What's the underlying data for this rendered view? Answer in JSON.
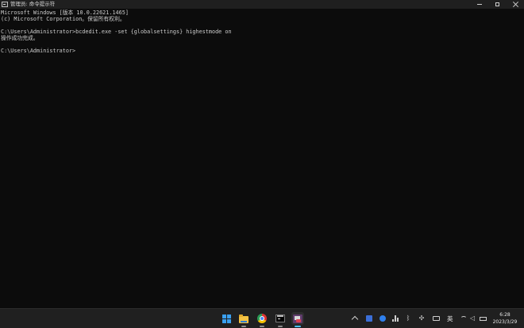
{
  "window": {
    "title": "管理员: 命令提示符",
    "minimize_icon": "minimize-icon",
    "maximize_icon": "maximize-icon",
    "close_icon": "close-icon"
  },
  "console": {
    "lines": [
      "Microsoft Windows [版本 10.0.22621.1465]",
      "(c) Microsoft Corporation。保留所有权利。",
      "",
      "C:\\Users\\Administrator>bcdedit.exe -set {globalsettings} highestmode on",
      "操作成功完成。",
      "",
      "C:\\Users\\Administrator>"
    ],
    "text_color": "#cccccc",
    "background": "#0c0c0c"
  },
  "taskbar": {
    "apps": [
      {
        "name": "start",
        "icon": "windows-logo-icon",
        "active": false
      },
      {
        "name": "file-explorer",
        "icon": "folder-icon",
        "active": false
      },
      {
        "name": "chrome",
        "icon": "chrome-icon",
        "active": false
      },
      {
        "name": "terminal",
        "icon": "terminal-icon",
        "active": false
      },
      {
        "name": "command-prompt",
        "icon": "cmd-icon",
        "active": true
      }
    ],
    "tray": {
      "ime_label": "英",
      "time": "6:28",
      "date": "2023/3/29"
    },
    "accent": "#4cc2ff"
  }
}
